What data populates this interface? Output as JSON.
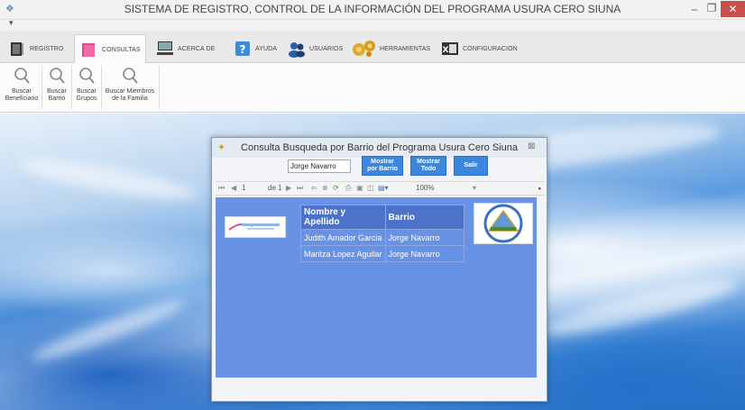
{
  "window": {
    "title": "SISTEMA DE REGISTRO, CONTROL DE LA INFORMACIÓN DEL PROGRAMA USURA CERO SIUNA",
    "controls": {
      "minimize": "–",
      "maximize": "❐",
      "close": "✕"
    }
  },
  "qat": {
    "arrow": "▾"
  },
  "ribbon": {
    "tabs": [
      {
        "label": "REGISTRO",
        "icon": "book-icon"
      },
      {
        "label": "CONSULTAS",
        "icon": "pink-folder-icon"
      },
      {
        "label": "ACERCA DE",
        "icon": "computer-icon"
      },
      {
        "label": "AYUDA",
        "icon": "help-icon"
      },
      {
        "label": "USUARIOS",
        "icon": "users-icon"
      },
      {
        "label": "HERRAMIENTAS",
        "icon": "gears-icon"
      },
      {
        "label": "CONFIGURACION",
        "icon": "excel-icon"
      }
    ],
    "active_tab": "CONSULTAS",
    "buttons": [
      {
        "line1": "Buscar",
        "line2": "Beneficiario"
      },
      {
        "line1": "Buscar",
        "line2": "Barrio"
      },
      {
        "line1": "Buscar",
        "line2": "Grupos"
      },
      {
        "line1": "Buscar Miembros",
        "line2": "de la Familia"
      }
    ]
  },
  "dialog": {
    "title": "Consulta Busqueda por Barrio del Programa Usura Cero Siuna",
    "close": "⊠",
    "search_value": "Jorge Navarro",
    "buttons": {
      "mostrar_barrio": {
        "line1": "Mostrar",
        "line2": "por Barrio"
      },
      "mostrar_todo": {
        "line1": "Mostrar",
        "line2": "Todo"
      },
      "salir": "Salir"
    },
    "viewer": {
      "page_current": "1",
      "page_of": "de 1",
      "zoom": "100%"
    },
    "report": {
      "headers": [
        "Nombre y Apellido",
        "Barrio"
      ],
      "rows": [
        [
          "Judith Amador Garcia",
          "Jorge Navarro"
        ],
        [
          "Maritza Lopez Aguilar",
          "Jorge Navarro"
        ]
      ]
    }
  },
  "colors": {
    "report_bg": "#6893e4",
    "header_bg": "#4d72c9",
    "button_bg": "#3b87e0",
    "close_red": "#c7504c"
  }
}
